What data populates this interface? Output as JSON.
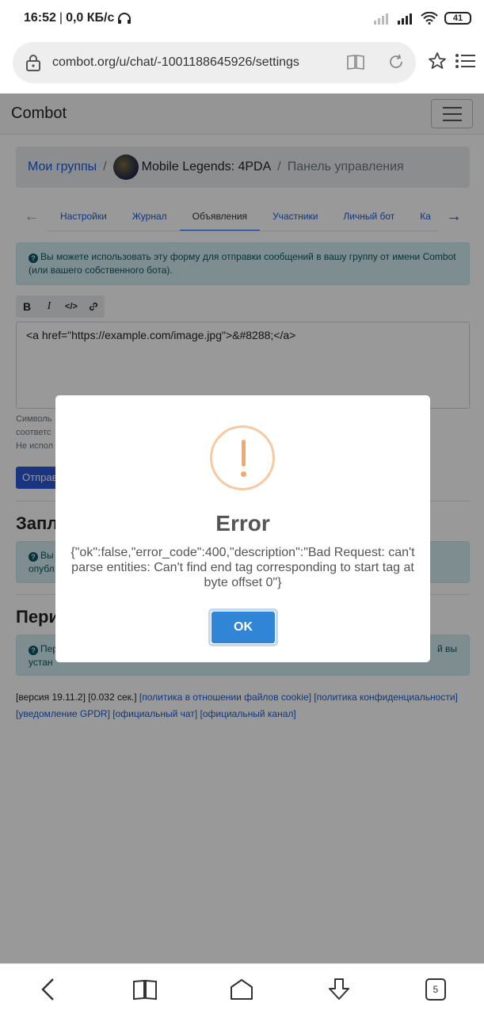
{
  "status_bar": {
    "time": "16:52",
    "separator": "|",
    "speed": "0,0 КБ/с",
    "battery": "41"
  },
  "browser": {
    "url": "combot.org/u/chat/-1001188645926/settings"
  },
  "page": {
    "brand": "Combot",
    "breadcrumb": {
      "home": "Мои группы",
      "sep": "/",
      "group": "Mobile Legends: 4PDA",
      "current": "Панель управления"
    },
    "tabs": [
      {
        "label": "Настройки"
      },
      {
        "label": "Журнал"
      },
      {
        "label": "Объявления"
      },
      {
        "label": "Участники"
      },
      {
        "label": "Личный бот"
      },
      {
        "label": "Ка"
      }
    ],
    "info_alert": "Вы можете использовать эту форму для отправки сообщений в вашу группу от имени Combot (или вашего собственного бота).",
    "toolbar": {
      "bold": "B",
      "italic": "I",
      "code": "</>"
    },
    "editor_value": "<a href=\"https://example.com/image.jpg\">&#8288;</a>",
    "help_lines": [
      "Символь",
      "соответс",
      "Не испол"
    ],
    "send_button": "Отправ",
    "section1_title": "Запл",
    "section1_alert_lines": [
      "Вы",
      "опубл"
    ],
    "section2_title": "Пери",
    "section2_alert_lines": [
      "Пер",
      "устан"
    ],
    "section2_alert_tail": "й вы",
    "footer": {
      "version": "[версия 19.11.2] [0.032 сек.]",
      "links": [
        "[политика в отношении файлов cookie]",
        "[политика конфиденциальности]",
        "[уведомление GPDR]",
        "[официальный чат]",
        "[официальный канал]"
      ]
    }
  },
  "modal": {
    "title": "Error",
    "message": "{\"ok\":false,\"error_code\":400,\"description\":\"Bad Request: can't parse entities: Can't find end tag corresponding to start tag at byte offset 0\"}",
    "ok_label": "OK"
  },
  "bottom_nav": {
    "tabs_count": "5"
  },
  "colors": {
    "accent": "#3085d6",
    "link": "#1a5bd6",
    "warning": "#f8bb86",
    "info_bg": "#d1ecf1"
  }
}
